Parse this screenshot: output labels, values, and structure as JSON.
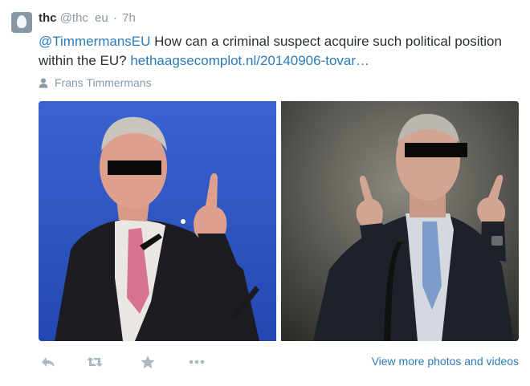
{
  "tweet": {
    "user_name": "thc",
    "handle": "@thc",
    "handle_suffix": "eu",
    "separator": "·",
    "time": "7h",
    "mention": "@TimmermansEU",
    "body": " How can a criminal suspect acquire such political position within the EU? ",
    "link_text": "hethaagsecomplot.nl/20140906-tovar…",
    "media_credit": "Frans Timmermans",
    "view_more": "View more photos and videos"
  },
  "icons": {
    "reply": "reply-icon",
    "retweet": "retweet-icon",
    "favorite": "star-icon",
    "more": "more-icon",
    "person": "person-icon"
  },
  "colors": {
    "link": "#2b7bb9",
    "meta": "#8899a6",
    "text": "#292f33",
    "left_photo_background": "#2c58c6",
    "right_photo_background": "#3b3a37"
  }
}
